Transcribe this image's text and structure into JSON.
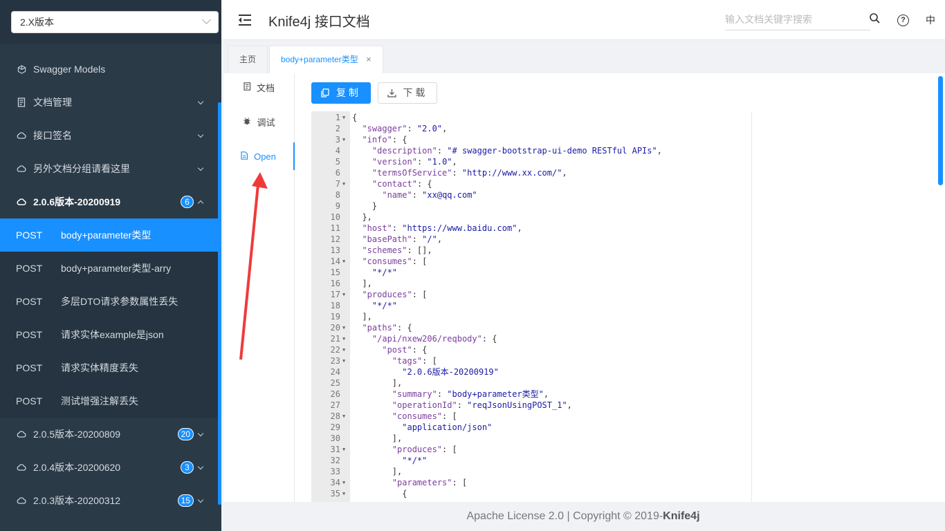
{
  "sidebar": {
    "version_select": "2.X版本",
    "menu": [
      {
        "label": "Swagger Models",
        "icon": "cube-icon",
        "has_arrow": false
      },
      {
        "label": "文档管理",
        "icon": "document-icon",
        "has_arrow": true
      },
      {
        "label": "接口签名",
        "icon": "cloud-icon",
        "has_arrow": true
      },
      {
        "label": "另外文档分组请看这里",
        "icon": "cloud-icon",
        "has_arrow": true
      }
    ],
    "open_group": {
      "label": "2.0.6版本-20200919",
      "badge": "6"
    },
    "sub_items": [
      {
        "method": "POST",
        "label": "body+parameter类型"
      },
      {
        "method": "POST",
        "label": "body+parameter类型-arry"
      },
      {
        "method": "POST",
        "label": "多层DTO请求参数属性丢失"
      },
      {
        "method": "POST",
        "label": "请求实体example是json"
      },
      {
        "method": "POST",
        "label": "请求实体精度丢失"
      },
      {
        "method": "POST",
        "label": "测试增强注解丢失"
      }
    ],
    "groups_after": [
      {
        "label": "2.0.5版本-20200809",
        "badge": "20"
      },
      {
        "label": "2.0.4版本-20200620",
        "badge": "3"
      },
      {
        "label": "2.0.3版本-20200312",
        "badge": "15"
      }
    ]
  },
  "header": {
    "title": "Knife4j 接口文档",
    "search_placeholder": "输入文档关键字搜索",
    "lang": "中",
    "help": "?"
  },
  "tabs": {
    "home": "主页",
    "active": "body+parameter类型",
    "close": "×"
  },
  "left_tabs": {
    "doc": "文档",
    "debug": "调试",
    "open": "Open"
  },
  "buttons": {
    "copy": "复制",
    "download": "下载"
  },
  "code_lines": [
    {
      "n": "1",
      "fold": true,
      "text": "{"
    },
    {
      "n": "2",
      "fold": false,
      "text": "  \"swagger\": \"2.0\","
    },
    {
      "n": "3",
      "fold": true,
      "text": "  \"info\": {"
    },
    {
      "n": "4",
      "fold": false,
      "text": "    \"description\": \"# swagger-bootstrap-ui-demo RESTful APIs\","
    },
    {
      "n": "5",
      "fold": false,
      "text": "    \"version\": \"1.0\","
    },
    {
      "n": "6",
      "fold": false,
      "text": "    \"termsOfService\": \"http://www.xx.com/\","
    },
    {
      "n": "7",
      "fold": true,
      "text": "    \"contact\": {"
    },
    {
      "n": "8",
      "fold": false,
      "text": "      \"name\": \"xx@qq.com\""
    },
    {
      "n": "9",
      "fold": false,
      "text": "    }"
    },
    {
      "n": "10",
      "fold": false,
      "text": "  },"
    },
    {
      "n": "11",
      "fold": false,
      "text": "  \"host\": \"https://www.baidu.com\","
    },
    {
      "n": "12",
      "fold": false,
      "text": "  \"basePath\": \"/\","
    },
    {
      "n": "13",
      "fold": false,
      "text": "  \"schemes\": [],"
    },
    {
      "n": "14",
      "fold": true,
      "text": "  \"consumes\": ["
    },
    {
      "n": "15",
      "fold": false,
      "text": "    \"*/*\""
    },
    {
      "n": "16",
      "fold": false,
      "text": "  ],"
    },
    {
      "n": "17",
      "fold": true,
      "text": "  \"produces\": ["
    },
    {
      "n": "18",
      "fold": false,
      "text": "    \"*/*\""
    },
    {
      "n": "19",
      "fold": false,
      "text": "  ],"
    },
    {
      "n": "20",
      "fold": true,
      "text": "  \"paths\": {"
    },
    {
      "n": "21",
      "fold": true,
      "text": "    \"/api/nxew206/reqbody\": {"
    },
    {
      "n": "22",
      "fold": true,
      "text": "      \"post\": {"
    },
    {
      "n": "23",
      "fold": true,
      "text": "        \"tags\": ["
    },
    {
      "n": "24",
      "fold": false,
      "text": "          \"2.0.6版本-20200919\""
    },
    {
      "n": "25",
      "fold": false,
      "text": "        ],"
    },
    {
      "n": "26",
      "fold": false,
      "text": "        \"summary\": \"body+parameter类型\","
    },
    {
      "n": "27",
      "fold": false,
      "text": "        \"operationId\": \"reqJsonUsingPOST_1\","
    },
    {
      "n": "28",
      "fold": true,
      "text": "        \"consumes\": ["
    },
    {
      "n": "29",
      "fold": false,
      "text": "          \"application/json\""
    },
    {
      "n": "30",
      "fold": false,
      "text": "        ],"
    },
    {
      "n": "31",
      "fold": true,
      "text": "        \"produces\": ["
    },
    {
      "n": "32",
      "fold": false,
      "text": "          \"*/*\""
    },
    {
      "n": "33",
      "fold": false,
      "text": "        ],"
    },
    {
      "n": "34",
      "fold": true,
      "text": "        \"parameters\": ["
    },
    {
      "n": "35",
      "fold": true,
      "text": "          {"
    }
  ],
  "footer": {
    "text": "Apache License 2.0 | Copyright ",
    "copyright_symbol": "©",
    "year": " 2019-",
    "brand": "Knife4j"
  },
  "colors": {
    "accent": "#1890ff",
    "sidebar_bg": "#2b3a47",
    "annotation_arrow": "#f03a3a"
  }
}
